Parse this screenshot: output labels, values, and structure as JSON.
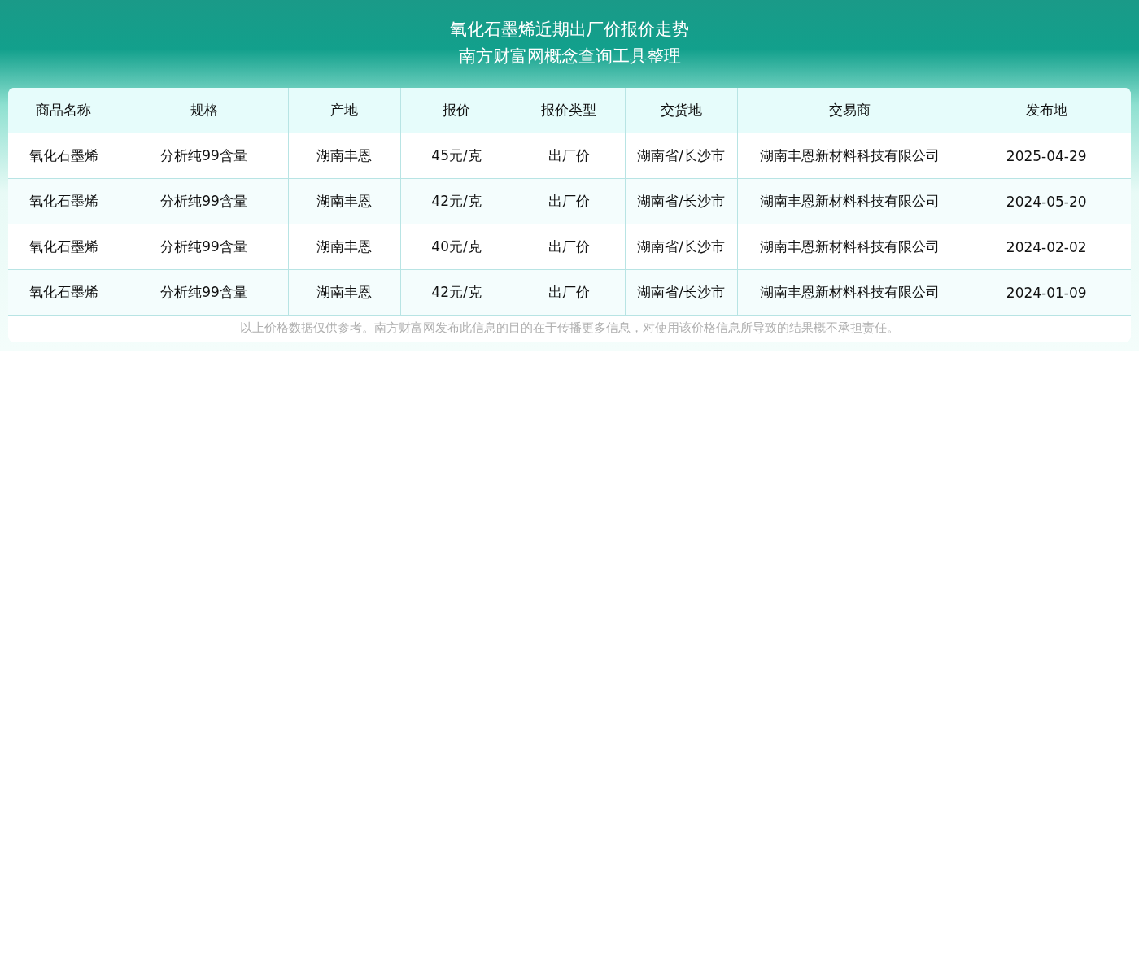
{
  "header": {
    "title": "氧化石墨烯近期出厂价报价走势",
    "subtitle": "南方财富网概念查询工具整理"
  },
  "table": {
    "columns": [
      "商品名称",
      "规格",
      "产地",
      "报价",
      "报价类型",
      "交货地",
      "交易商",
      "发布地"
    ],
    "rows": [
      [
        "氧化石墨烯",
        "分析纯99含量",
        "湖南丰恩",
        "45元/克",
        "出厂价",
        "湖南省/长沙市",
        "湖南丰恩新材料科技有限公司",
        "2025-04-29"
      ],
      [
        "氧化石墨烯",
        "分析纯99含量",
        "湖南丰恩",
        "42元/克",
        "出厂价",
        "湖南省/长沙市",
        "湖南丰恩新材料科技有限公司",
        "2024-05-20"
      ],
      [
        "氧化石墨烯",
        "分析纯99含量",
        "湖南丰恩",
        "40元/克",
        "出厂价",
        "湖南省/长沙市",
        "湖南丰恩新材料科技有限公司",
        "2024-02-02"
      ],
      [
        "氧化石墨烯",
        "分析纯99含量",
        "湖南丰恩",
        "42元/克",
        "出厂价",
        "湖南省/长沙市",
        "湖南丰恩新材料科技有限公司",
        "2024-01-09"
      ]
    ]
  },
  "disclaimer": "以上价格数据仅供参考。南方财富网发布此信息的目的在于传播更多信息，对使用该价格信息所导致的结果概不承担责任。"
}
